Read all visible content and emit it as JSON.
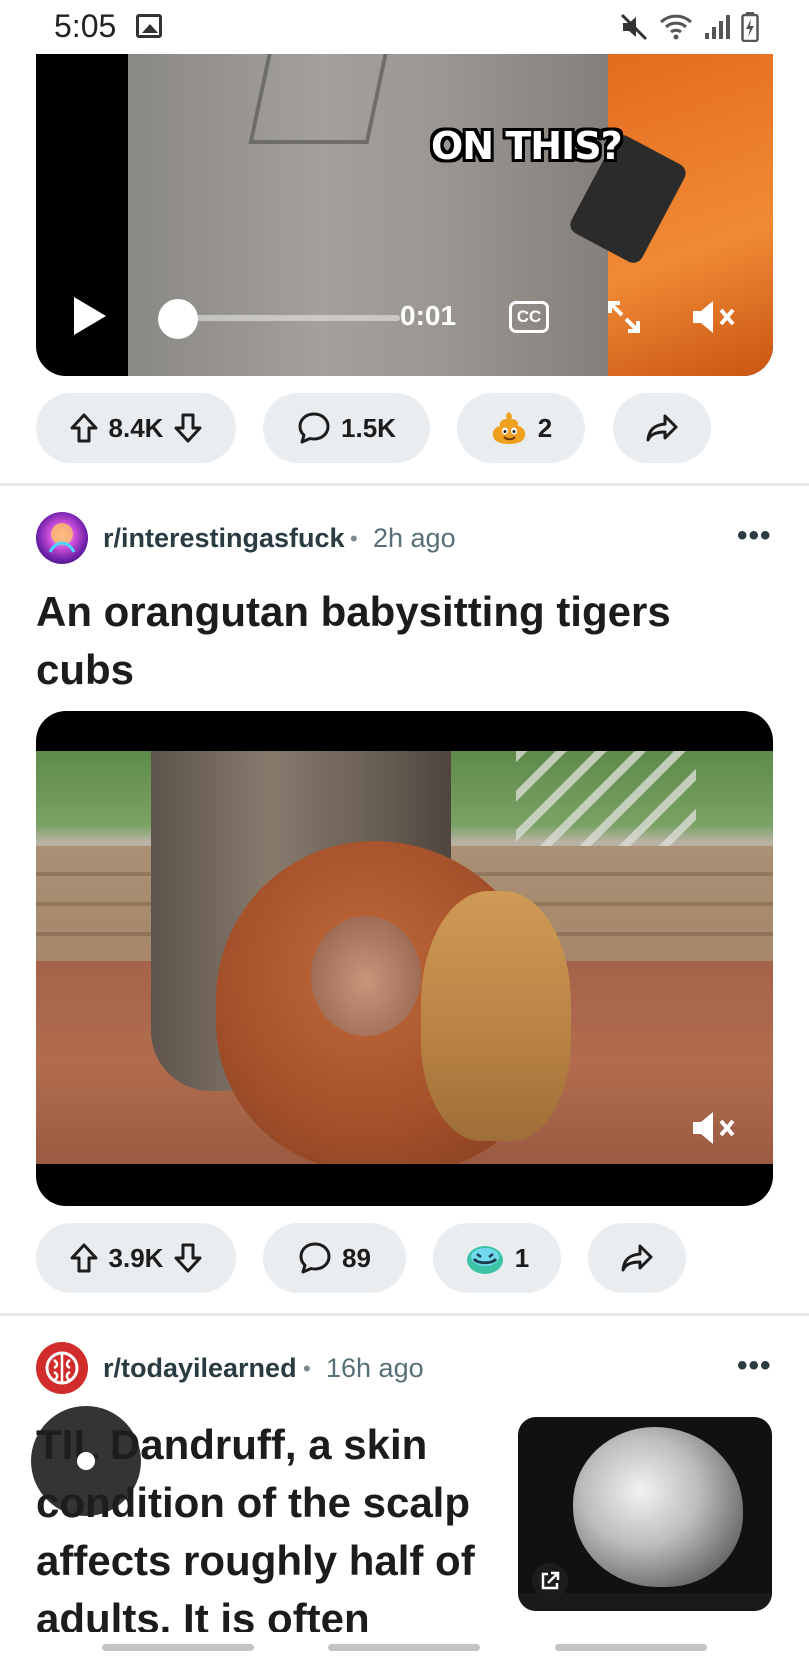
{
  "status_bar": {
    "time": "5:05"
  },
  "post1": {
    "video": {
      "caption": "ON THIS?",
      "time": "0:01",
      "cc_label": "CC"
    },
    "actions": {
      "votes": "8.4K",
      "comments": "1.5K",
      "award_count": "2"
    }
  },
  "post2": {
    "subreddit": "r/interestingasfuck",
    "separator": "•",
    "age": "2h ago",
    "more": "•••",
    "title_line1": "An orangutan babysitting tigers",
    "title_line2": "cubs",
    "actions": {
      "votes": "3.9K",
      "comments": "89",
      "award_count": "1"
    }
  },
  "post3": {
    "subreddit": "r/todayilearned",
    "separator": "•",
    "age": "16h ago",
    "more": "•••",
    "title_lines": [
      "TIL Dandruff, a skin",
      "condition of the scalp",
      "affects roughly half of",
      "adults. It is often"
    ]
  }
}
